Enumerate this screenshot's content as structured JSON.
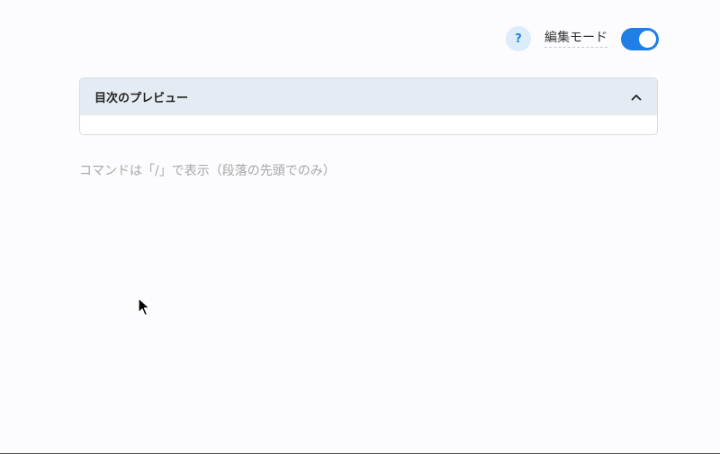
{
  "header": {
    "help_label": "?",
    "mode_label": "編集モード",
    "mode_enabled": true,
    "accent_color": "#1f7fe6"
  },
  "toc": {
    "title": "目次のプレビュー",
    "expanded": true
  },
  "editor": {
    "placeholder": "コマンドは「/」で表示（段落の先頭でのみ）"
  }
}
